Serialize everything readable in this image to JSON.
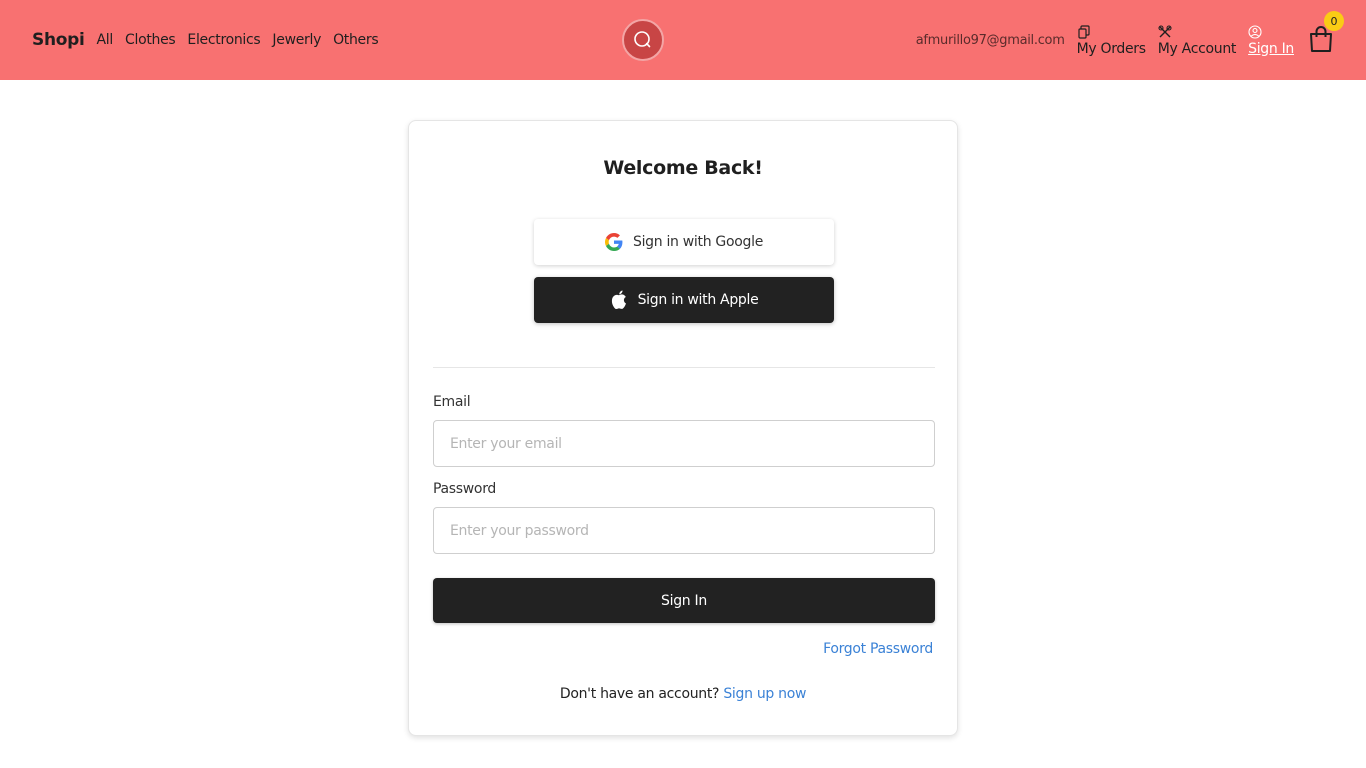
{
  "navbar": {
    "brand": "Shopi",
    "links": [
      "All",
      "Clothes",
      "Electronics",
      "Jewerly",
      "Others"
    ],
    "user_email": "afmurillo97@gmail.com",
    "my_orders": "My Orders",
    "my_account": "My Account",
    "sign_in": "Sign In",
    "cart_count": "0",
    "background_color": "#f87171"
  },
  "card": {
    "title": "Welcome Back!",
    "google_label": "Sign in with Google",
    "apple_label": "Sign in with Apple",
    "email_label": "Email",
    "email_placeholder": "Enter your email",
    "password_label": "Password",
    "password_placeholder": "Enter your password",
    "submit_label": "Sign In",
    "forgot_label": "Forgot Password",
    "no_account_text": "Don't have an account?",
    "signup_label": "Sign up now",
    "link_color": "#3b82d6"
  }
}
